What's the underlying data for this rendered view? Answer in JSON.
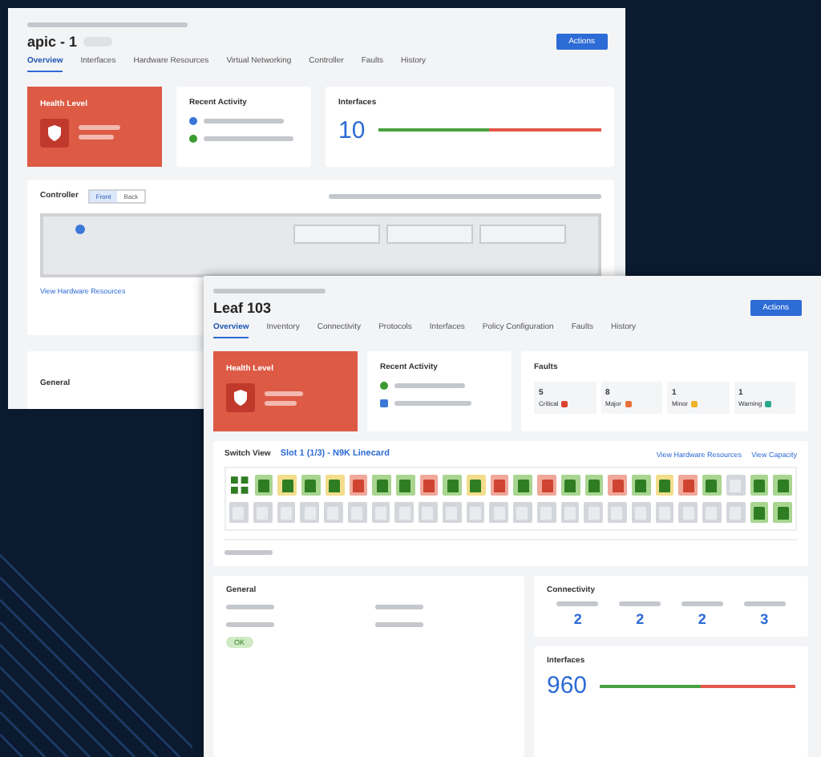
{
  "back_window": {
    "title": "apic - 1",
    "actions_button": "Actions",
    "tabs": [
      {
        "label": "Overview",
        "selected": true
      },
      {
        "label": "Interfaces",
        "selected": false
      },
      {
        "label": "Hardware Resources",
        "selected": false
      },
      {
        "label": "Virtual Networking",
        "selected": false
      },
      {
        "label": "Controller",
        "selected": false
      },
      {
        "label": "Faults",
        "selected": false
      },
      {
        "label": "History",
        "selected": false
      }
    ],
    "health_card": {
      "title": "Health Level"
    },
    "activity_card": {
      "title": "Recent Activity"
    },
    "interfaces_card": {
      "title": "Interfaces",
      "count": "10",
      "level": 0.5
    },
    "controller_panel": {
      "title": "Controller",
      "views": [
        {
          "label": "Front",
          "selected": true
        },
        {
          "label": "Back",
          "selected": false
        }
      ],
      "link": "View Hardware Resources"
    },
    "general_panel": {
      "title": "General"
    }
  },
  "front_window": {
    "title": "Leaf 103",
    "actions_button": "Actions",
    "tabs": [
      {
        "label": "Overview",
        "selected": true
      },
      {
        "label": "Inventory",
        "selected": false
      },
      {
        "label": "Connectivity",
        "selected": false
      },
      {
        "label": "Protocols",
        "selected": false
      },
      {
        "label": "Interfaces",
        "selected": false
      },
      {
        "label": "Policy Configuration",
        "selected": false
      },
      {
        "label": "Faults",
        "selected": false
      },
      {
        "label": "History",
        "selected": false
      }
    ],
    "health_card": {
      "title": "Health Level"
    },
    "activity_card": {
      "title": "Recent Activity"
    },
    "faults_card": {
      "title": "Faults",
      "counts": [
        {
          "value": "5",
          "label": "Critical",
          "color": "#d9442f"
        },
        {
          "value": "8",
          "label": "Major",
          "color": "#e8703a"
        },
        {
          "value": "1",
          "label": "Minor",
          "color": "#f0b429"
        },
        {
          "value": "1",
          "label": "Warning",
          "color": "#2aa88a"
        }
      ]
    },
    "switch_view": {
      "title": "Switch View",
      "slot": "Slot 1 (1/3) - N9K Linecard",
      "links": [
        "View Hardware Resources",
        "View Capacity"
      ],
      "ports_top": [
        {
          "kind": "up"
        },
        {
          "kind": "warn"
        },
        {
          "kind": "up"
        },
        {
          "kind": "warn"
        },
        {
          "kind": "down"
        },
        {
          "kind": "up"
        },
        {
          "kind": "up"
        },
        {
          "kind": "down"
        },
        {
          "kind": "up"
        },
        {
          "kind": "warn"
        },
        {
          "kind": "down"
        },
        {
          "kind": "up"
        },
        {
          "kind": "down"
        },
        {
          "kind": "up"
        },
        {
          "kind": "up"
        },
        {
          "kind": "down"
        },
        {
          "kind": "up"
        },
        {
          "kind": "warn"
        },
        {
          "kind": "down"
        },
        {
          "kind": "up"
        },
        {
          "kind": "empty"
        },
        {
          "kind": "up"
        },
        {
          "kind": "up"
        }
      ],
      "ports_bottom": [
        {
          "kind": "empty"
        },
        {
          "kind": "empty"
        },
        {
          "kind": "empty"
        },
        {
          "kind": "empty"
        },
        {
          "kind": "empty"
        },
        {
          "kind": "empty"
        },
        {
          "kind": "empty"
        },
        {
          "kind": "empty"
        },
        {
          "kind": "empty"
        },
        {
          "kind": "empty"
        },
        {
          "kind": "empty"
        },
        {
          "kind": "empty"
        },
        {
          "kind": "empty"
        },
        {
          "kind": "empty"
        },
        {
          "kind": "empty"
        },
        {
          "kind": "empty"
        },
        {
          "kind": "empty"
        },
        {
          "kind": "empty"
        },
        {
          "kind": "empty"
        },
        {
          "kind": "empty"
        },
        {
          "kind": "empty"
        },
        {
          "kind": "empty"
        },
        {
          "kind": "up"
        },
        {
          "kind": "up"
        }
      ]
    },
    "general_panel": {
      "title": "General",
      "status_badge": "OK"
    },
    "connectivity_panel": {
      "title": "Connectivity",
      "values": [
        "2",
        "2",
        "2",
        "3"
      ]
    },
    "interfaces_panel": {
      "title": "Interfaces",
      "count": "960",
      "level": 0.52
    }
  }
}
